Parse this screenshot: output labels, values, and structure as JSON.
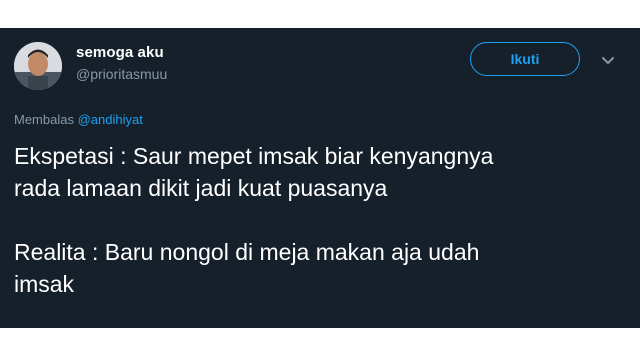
{
  "user": {
    "display_name": "semoga aku",
    "handle": "@prioritasmuu"
  },
  "follow_button": {
    "label": "Ikuti"
  },
  "reply": {
    "prefix": "Membalas",
    "mention": "@andihiyat"
  },
  "tweet": {
    "lines": [
      "Ekspetasi : Saur mepet imsak biar kenyangnya",
      "rada lamaan dikit jadi kuat puasanya",
      "Realita : Baru nongol di meja makan aja udah",
      "imsak"
    ]
  },
  "colors": {
    "card_background": "#15202b",
    "accent": "#1da1f2",
    "secondary_text": "#8899a6"
  },
  "icons": {
    "menu": "chevron-down-icon"
  }
}
